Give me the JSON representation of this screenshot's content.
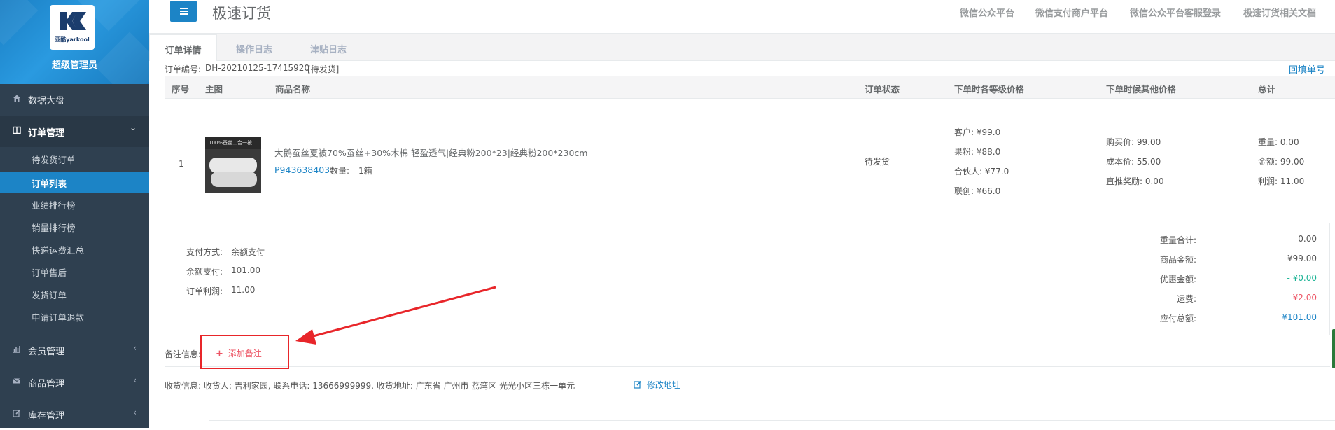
{
  "sidebar": {
    "brand": "亚酷yarkool",
    "role": "超级管理员",
    "items": [
      {
        "label": "数据大盘",
        "icon": "home-icon"
      },
      {
        "label": "订单管理",
        "icon": "columns-icon",
        "arrow": "⌄"
      },
      {
        "label": "会员管理",
        "icon": "bar-chart-icon",
        "arrow": "‹"
      },
      {
        "label": "商品管理",
        "icon": "envelope-icon",
        "arrow": "‹"
      },
      {
        "label": "库存管理",
        "icon": "edit-icon",
        "arrow": "‹"
      }
    ],
    "sub_items": [
      "待发货订单",
      "订单列表",
      "业绩排行榜",
      "销量排行榜",
      "快递运费汇总",
      "订单售后",
      "发货订单",
      "申请订单退款"
    ]
  },
  "header": {
    "title": "极速订货",
    "links": [
      "微信公众平台",
      "微信支付商户平台",
      "微信公众平台客服登录",
      "极速订货相关文档"
    ]
  },
  "tabs": [
    "订单详情",
    "操作日志",
    "津贴日志"
  ],
  "order": {
    "number_label": "订单编号:",
    "number": "DH-20210125-17415920",
    "status_tag": "[待发货]",
    "backfill_link": "回填单号"
  },
  "table": {
    "headers": [
      "序号",
      "主图",
      "商品名称",
      "订单状态",
      "下单时各等级价格",
      "下单时候其他价格",
      "总计"
    ],
    "row": {
      "index": "1",
      "thumb_text": "100%蚕丝二合一被",
      "name": "大鹅蚕丝夏被70%蚕丝+30%木棉 轻盈透气|经典粉200*23|经典粉200*230cm",
      "sku": "P943638403",
      "qty_label": "数量:",
      "qty": "1箱",
      "status": "待发货",
      "level_prices": [
        "客户: ¥99.0",
        "果粉: ¥88.0",
        "合伙人: ¥77.0",
        "联创: ¥66.0"
      ],
      "other_prices": [
        "购买价: 99.00",
        "成本价: 55.00",
        "直推奖励: 0.00"
      ],
      "totals": [
        "重量: 0.00",
        "金额: 99.00",
        "利润: 11.00"
      ]
    }
  },
  "summary": {
    "left": [
      {
        "label": "支付方式:",
        "value": "余额支付"
      },
      {
        "label": "余额支付:",
        "value": "101.00"
      },
      {
        "label": "订单利润:",
        "value": "11.00"
      }
    ],
    "right": [
      {
        "label": "重量合计:",
        "value": "0.00",
        "color": "#555555"
      },
      {
        "label": "商品金额:",
        "value": "¥99.00",
        "color": "#555555"
      },
      {
        "label": "优惠金额:",
        "value": "- ¥0.00",
        "color": "#1ab394"
      },
      {
        "label": "运费:",
        "value": "¥2.00",
        "color": "#ed5565"
      },
      {
        "label": "应付总额:",
        "value": "¥101.00",
        "color": "#1c84c6"
      }
    ]
  },
  "remark": {
    "label": "备注信息:",
    "add_button": "添加备注"
  },
  "shipping": {
    "text": "收货信息: 收货人: 吉利家园, 联系电话: 13666999999, 收货地址: 广东省 广州市 荔湾区 光光小区三栋一单元",
    "edit_link": "修改地址"
  },
  "colors": {
    "accent": "#1c84c6",
    "sidebar": "#2f4050",
    "highlight": "#e8262a"
  }
}
